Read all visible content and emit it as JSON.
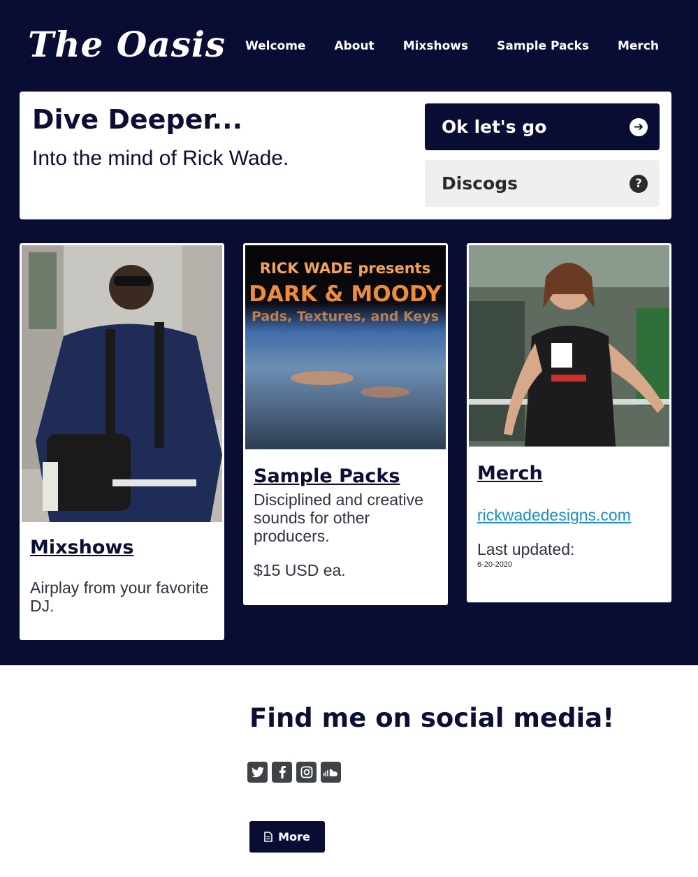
{
  "brand": "The Oasis",
  "nav": [
    "Welcome",
    "About",
    "Mixshows",
    "Sample Packs",
    "Merch"
  ],
  "hero": {
    "title": "Dive Deeper...",
    "subtitle": "Into the mind of Rick Wade.",
    "primary_button": "Ok let's go",
    "secondary_button": "Discogs"
  },
  "cards": [
    {
      "title": "Mixshows",
      "text": "Airplay from your favorite DJ."
    },
    {
      "title": "Sample Packs",
      "text": "Disciplined and creative sounds for other producers.",
      "price": "$15 USD ea.",
      "image_text": {
        "line1": "RICK WADE presents",
        "line2": "DARK & MOODY",
        "line3": "Pads, Textures, and Keys"
      }
    },
    {
      "title": "Merch",
      "link": "rickwadedesigns.com",
      "updated_label": "Last updated:",
      "updated_date": "6-20-2020"
    }
  ],
  "social": {
    "heading": "Find me on social media!",
    "icons": [
      "twitter-icon",
      "facebook-icon",
      "instagram-icon",
      "soundcloud-icon"
    ]
  },
  "more_button": "More",
  "colors": {
    "navy": "#090d33",
    "white": "#ffffff",
    "light_gray": "#efefef",
    "link_blue": "#1a8fc9"
  }
}
